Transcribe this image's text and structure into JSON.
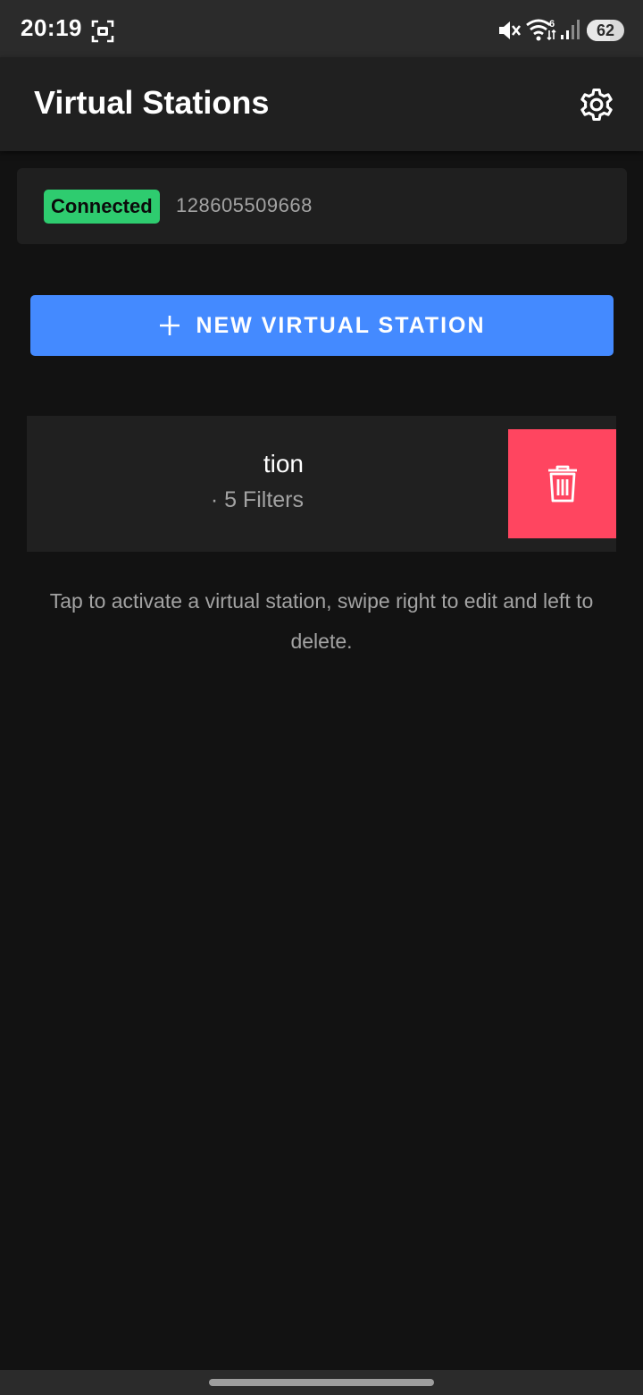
{
  "status_bar": {
    "time": "20:19",
    "battery_level": "62",
    "battery_fraction": 0.62,
    "wifi_badge": "6",
    "icons": [
      "screen-record-icon",
      "mute-icon",
      "wifi-icon",
      "signal-icon",
      "battery-icon"
    ]
  },
  "app_bar": {
    "title": "Virtual Stations",
    "settings_icon": "gear-icon"
  },
  "connection": {
    "status": "Connected",
    "device_id": "128605509668",
    "status_color": "#2ecc6f"
  },
  "new_station": {
    "label": "NEW VIRTUAL STATION",
    "icon": "plus-icon",
    "color": "#448aff"
  },
  "stations": [
    {
      "name": "tion",
      "meta": "· 5 Filters",
      "delete_icon": "trash-icon",
      "delete_color": "#ff4560"
    }
  ],
  "hint": "Tap to activate a virtual station, swipe right to edit and left to delete."
}
